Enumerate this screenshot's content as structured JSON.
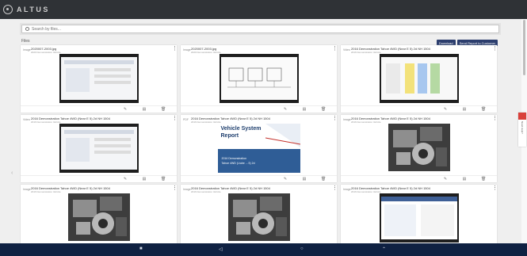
{
  "app": {
    "brand": "ALTUS",
    "colors": {
      "topbar": "#2f3236",
      "accent": "#2c3e6e",
      "navbar": "#0f2142",
      "alert": "#d9403a"
    }
  },
  "search": {
    "placeholder": "Search by files..."
  },
  "toolbar": {
    "files_label": "Files",
    "download_label": "Download",
    "send_label": "Send Report to Customer"
  },
  "cards": [
    {
      "type": "Image",
      "title": "2020007-2003.jpg",
      "meta": "2020 Demonstration Vehicle",
      "thumb": "dark-screenshot"
    },
    {
      "type": "Image",
      "title": "2020007-2003.jpg",
      "meta": "2020 Demonstration Vehicle",
      "thumb": "wiring-screenshot"
    },
    {
      "type": "Video",
      "title": "2016 Demonstration Tahoe 4WD (Near E 5) 2d NH 1504",
      "meta": "2016 Demonstration Vehicle",
      "thumb": "colored-screenshot"
    },
    {
      "type": "Video",
      "title": "2016 Demonstration Tahoe 4WD (Near E 5) 2d NH 1504",
      "meta": "2016 Demonstration Vehicle",
      "thumb": "plain-screenshot"
    },
    {
      "type": "PDF",
      "title": "2016 Demonstration Tahoe 4WD (Near E 5) 2d NH 1504",
      "meta": "2016 Demonstration Vehicle",
      "thumb": "report",
      "report": {
        "title_line1": "Vehicle System",
        "title_line2": "Report",
        "sub_line1": "2016 Demonstration",
        "sub_line2": "Tahoe 4WD (Ltube ... 5) 2d"
      }
    },
    {
      "type": "Image",
      "title": "2016 Demonstration Tahoe 4WD (Near E 5) 2d NH 1504",
      "meta": "2016 Demonstration Vehicle",
      "thumb": "engine-photo"
    },
    {
      "type": "Image",
      "title": "2016 Demonstration Tahoe 4WD (Near E 5) 2d NH 1504",
      "meta": "2016 Demonstration Vehicle",
      "thumb": "engine-photo"
    },
    {
      "type": "Image",
      "title": "2016 Demonstration Tahoe 4WD (Near E 5) 2d NH 1504",
      "meta": "2016 Demonstration Vehicle",
      "thumb": "engine-photo"
    },
    {
      "type": "Image",
      "title": "2016 Demonstration Tahoe 4WD (Near E 5) 2d NH 1504",
      "meta": "2016 Demonstration Vehicle",
      "thumb": "data-screenshot"
    }
  ],
  "side_tab": {
    "label": "Need Help?"
  },
  "navbar": {
    "icons": [
      "home-icon",
      "back-icon",
      "recents-icon",
      "up-icon"
    ]
  }
}
